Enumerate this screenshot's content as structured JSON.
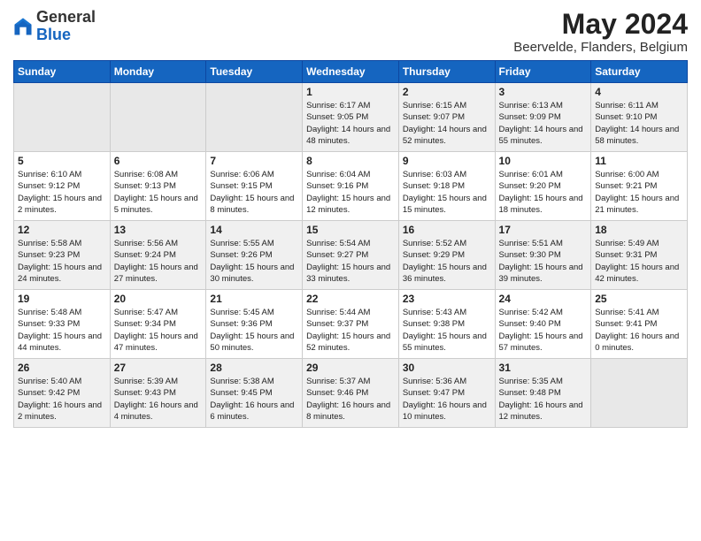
{
  "logo": {
    "general": "General",
    "blue": "Blue"
  },
  "header": {
    "month_title": "May 2024",
    "location": "Beervelde, Flanders, Belgium"
  },
  "days_of_week": [
    "Sunday",
    "Monday",
    "Tuesday",
    "Wednesday",
    "Thursday",
    "Friday",
    "Saturday"
  ],
  "weeks": [
    [
      {
        "day": "",
        "info": ""
      },
      {
        "day": "",
        "info": ""
      },
      {
        "day": "",
        "info": ""
      },
      {
        "day": "1",
        "info": "Sunrise: 6:17 AM\nSunset: 9:05 PM\nDaylight: 14 hours\nand 48 minutes."
      },
      {
        "day": "2",
        "info": "Sunrise: 6:15 AM\nSunset: 9:07 PM\nDaylight: 14 hours\nand 52 minutes."
      },
      {
        "day": "3",
        "info": "Sunrise: 6:13 AM\nSunset: 9:09 PM\nDaylight: 14 hours\nand 55 minutes."
      },
      {
        "day": "4",
        "info": "Sunrise: 6:11 AM\nSunset: 9:10 PM\nDaylight: 14 hours\nand 58 minutes."
      }
    ],
    [
      {
        "day": "5",
        "info": "Sunrise: 6:10 AM\nSunset: 9:12 PM\nDaylight: 15 hours\nand 2 minutes."
      },
      {
        "day": "6",
        "info": "Sunrise: 6:08 AM\nSunset: 9:13 PM\nDaylight: 15 hours\nand 5 minutes."
      },
      {
        "day": "7",
        "info": "Sunrise: 6:06 AM\nSunset: 9:15 PM\nDaylight: 15 hours\nand 8 minutes."
      },
      {
        "day": "8",
        "info": "Sunrise: 6:04 AM\nSunset: 9:16 PM\nDaylight: 15 hours\nand 12 minutes."
      },
      {
        "day": "9",
        "info": "Sunrise: 6:03 AM\nSunset: 9:18 PM\nDaylight: 15 hours\nand 15 minutes."
      },
      {
        "day": "10",
        "info": "Sunrise: 6:01 AM\nSunset: 9:20 PM\nDaylight: 15 hours\nand 18 minutes."
      },
      {
        "day": "11",
        "info": "Sunrise: 6:00 AM\nSunset: 9:21 PM\nDaylight: 15 hours\nand 21 minutes."
      }
    ],
    [
      {
        "day": "12",
        "info": "Sunrise: 5:58 AM\nSunset: 9:23 PM\nDaylight: 15 hours\nand 24 minutes."
      },
      {
        "day": "13",
        "info": "Sunrise: 5:56 AM\nSunset: 9:24 PM\nDaylight: 15 hours\nand 27 minutes."
      },
      {
        "day": "14",
        "info": "Sunrise: 5:55 AM\nSunset: 9:26 PM\nDaylight: 15 hours\nand 30 minutes."
      },
      {
        "day": "15",
        "info": "Sunrise: 5:54 AM\nSunset: 9:27 PM\nDaylight: 15 hours\nand 33 minutes."
      },
      {
        "day": "16",
        "info": "Sunrise: 5:52 AM\nSunset: 9:29 PM\nDaylight: 15 hours\nand 36 minutes."
      },
      {
        "day": "17",
        "info": "Sunrise: 5:51 AM\nSunset: 9:30 PM\nDaylight: 15 hours\nand 39 minutes."
      },
      {
        "day": "18",
        "info": "Sunrise: 5:49 AM\nSunset: 9:31 PM\nDaylight: 15 hours\nand 42 minutes."
      }
    ],
    [
      {
        "day": "19",
        "info": "Sunrise: 5:48 AM\nSunset: 9:33 PM\nDaylight: 15 hours\nand 44 minutes."
      },
      {
        "day": "20",
        "info": "Sunrise: 5:47 AM\nSunset: 9:34 PM\nDaylight: 15 hours\nand 47 minutes."
      },
      {
        "day": "21",
        "info": "Sunrise: 5:45 AM\nSunset: 9:36 PM\nDaylight: 15 hours\nand 50 minutes."
      },
      {
        "day": "22",
        "info": "Sunrise: 5:44 AM\nSunset: 9:37 PM\nDaylight: 15 hours\nand 52 minutes."
      },
      {
        "day": "23",
        "info": "Sunrise: 5:43 AM\nSunset: 9:38 PM\nDaylight: 15 hours\nand 55 minutes."
      },
      {
        "day": "24",
        "info": "Sunrise: 5:42 AM\nSunset: 9:40 PM\nDaylight: 15 hours\nand 57 minutes."
      },
      {
        "day": "25",
        "info": "Sunrise: 5:41 AM\nSunset: 9:41 PM\nDaylight: 16 hours\nand 0 minutes."
      }
    ],
    [
      {
        "day": "26",
        "info": "Sunrise: 5:40 AM\nSunset: 9:42 PM\nDaylight: 16 hours\nand 2 minutes."
      },
      {
        "day": "27",
        "info": "Sunrise: 5:39 AM\nSunset: 9:43 PM\nDaylight: 16 hours\nand 4 minutes."
      },
      {
        "day": "28",
        "info": "Sunrise: 5:38 AM\nSunset: 9:45 PM\nDaylight: 16 hours\nand 6 minutes."
      },
      {
        "day": "29",
        "info": "Sunrise: 5:37 AM\nSunset: 9:46 PM\nDaylight: 16 hours\nand 8 minutes."
      },
      {
        "day": "30",
        "info": "Sunrise: 5:36 AM\nSunset: 9:47 PM\nDaylight: 16 hours\nand 10 minutes."
      },
      {
        "day": "31",
        "info": "Sunrise: 5:35 AM\nSunset: 9:48 PM\nDaylight: 16 hours\nand 12 minutes."
      },
      {
        "day": "",
        "info": ""
      }
    ]
  ]
}
